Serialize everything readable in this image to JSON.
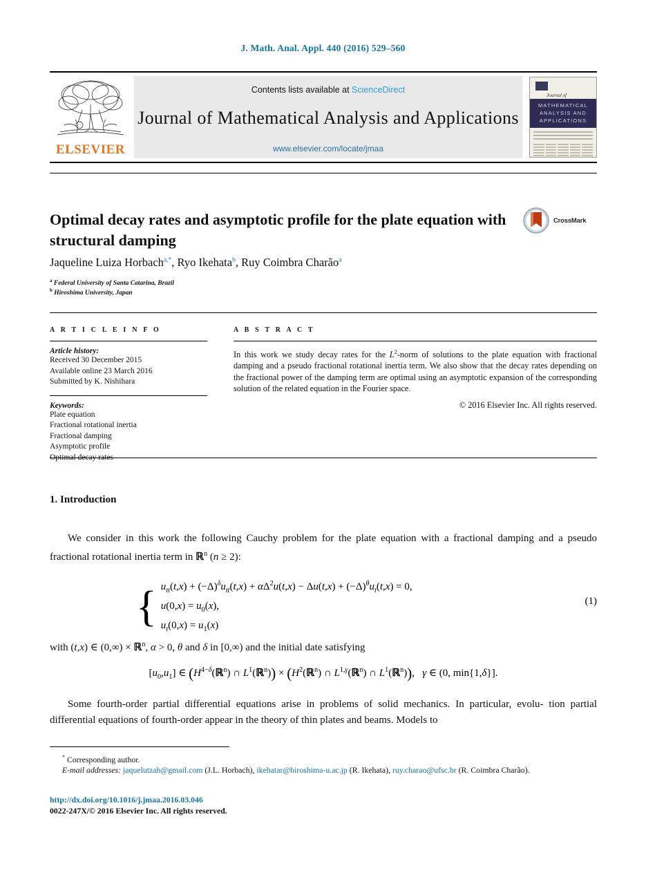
{
  "running_head": "J. Math. Anal. Appl. 440 (2016) 529–560",
  "masthead": {
    "contents_prefix": "Contents lists available at",
    "sciencedirect": "ScienceDirect",
    "journal_title": "Journal of Mathematical Analysis and Applications",
    "journal_url": "www.elsevier.com/locate/jmaa",
    "publisher": "ELSEVIER",
    "cover": {
      "script_label": "Journal of",
      "band_line1": "MATHEMATICAL",
      "band_line2": "ANALYSIS AND",
      "band_line3": "APPLICATIONS"
    }
  },
  "article": {
    "title": "Optimal decay rates and asymptotic profile for the plate equation with structural damping",
    "crossmark_label": "CrossMark",
    "authors_html": "Jaqueline Luiza Horbach<sup>a,*</sup>, Ryo Ikehata<sup>b</sup>, Ruy Coimbra Charão<sup>a</sup>",
    "affiliation_a": "Federal University of Santa Catarina, Brazil",
    "affiliation_b": "Hiroshima University, Japan",
    "affiliation_a_marker": "a",
    "affiliation_b_marker": "b"
  },
  "info": {
    "heading": "A R T I C L E   I N F O",
    "history_label": "Article history:",
    "history": [
      "Received 30 December 2015",
      "Available online 23 March 2016",
      "Submitted by K. Nishihara"
    ],
    "keywords_label": "Keywords:",
    "keywords": [
      "Plate equation",
      "Fractional rotational inertia",
      "Fractional damping",
      "Asymptotic profile",
      "Optimal decay rates"
    ]
  },
  "abstract": {
    "heading": "A B S T R A C T",
    "text": "In this work we study decay rates for the L²-norm of solutions to the plate equation with fractional damping and a pseudo fractional rotational inertia term. We also show that the decay rates depending on the fractional power of the damping term are optimal using an asymptotic expansion of the corresponding solution of the related equation in the Fourier space.",
    "copyright": "© 2016 Elsevier Inc. All rights reserved."
  },
  "body": {
    "section_number_title": "1. Introduction",
    "paragraph_1": "We consider in this work the following Cauchy problem for the plate equation with a fractional damping and a pseudo fractional rotational inertia term in ℝⁿ (n ≥ 2):",
    "equation_1": {
      "line1": "u_tt(t,x) + (−Δ)^δ u_tt(t,x) + αΔ²u(t,x) − Δu(t,x) + (−Δ)^θ u_t(t,x) = 0,",
      "line2": "u(0,x) = u₀(x),",
      "line3": "u_t(0,x) = u₁(x)",
      "number": "(1)"
    },
    "paragraph_with": "with (t,x) ∈ (0,∞) × ℝⁿ, α > 0, θ and δ in [0,∞) and the initial date satisfying",
    "equation_display": "[u₀,u₁] ∈ ( H^{4−δ}(ℝⁿ) ∩ L¹(ℝⁿ) ) × ( H²(ℝⁿ) ∩ L^{1,γ}(ℝⁿ) ∩ L¹(ℝⁿ) ),   γ ∈ (0, min{1,δ}].",
    "paragraph_last": "Some fourth-order partial differential equations arise in problems of solid mechanics. In particular, evolution partial differential equations of fourth-order appear in the theory of thin plates and beams. Models to"
  },
  "footnotes": {
    "corresponding_marker": "*",
    "corresponding_text": "Corresponding author.",
    "email_label": "E-mail addresses:",
    "emails": [
      {
        "address": "jaquelutzah@gmail.com",
        "owner": "(J.L. Horbach),"
      },
      {
        "address": "ikehatar@hiroshima-u.ac.jp",
        "owner": "(R. Ikehata),"
      },
      {
        "address": "ruy.charao@ufsc.br",
        "owner": "(R. Coimbra Charão)."
      }
    ]
  },
  "footer": {
    "doi": "http://dx.doi.org/10.1016/j.jmaa.2016.03.046",
    "issn_line": "0022-247X/© 2016 Elsevier Inc. All rights reserved."
  },
  "colors": {
    "link": "#1076a8",
    "sciencedirect": "#2a9fd6",
    "elsevier_orange": "#e87722",
    "cover_band": "#2e2b55"
  }
}
